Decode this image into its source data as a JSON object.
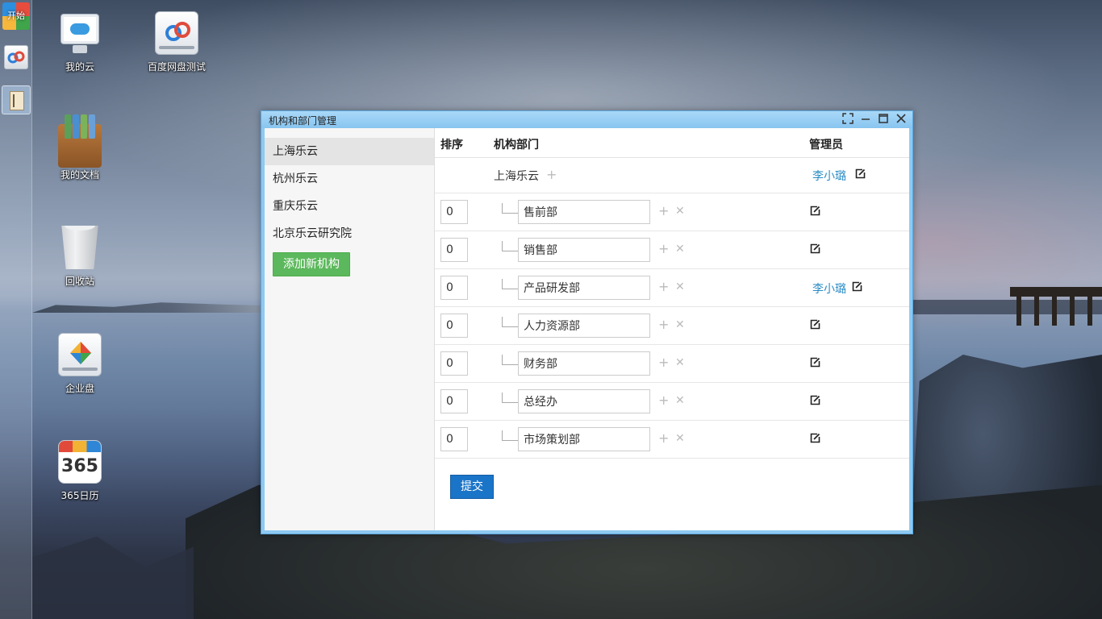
{
  "taskbar": {
    "start_label": "开始"
  },
  "desktop": {
    "icons": [
      {
        "label": "我的云"
      },
      {
        "label": "百度网盘测试"
      },
      {
        "label": "我的文档"
      },
      {
        "label": "回收站"
      },
      {
        "label": "企业盘"
      },
      {
        "label": "365日历",
        "badge": "365"
      }
    ]
  },
  "window": {
    "title": "机构和部门管理",
    "buttons": [
      "fullscreen-icon",
      "minimize-icon",
      "maximize-icon",
      "close-icon"
    ],
    "organizations": [
      "上海乐云",
      "杭州乐云",
      "重庆乐云",
      "北京乐云研究院"
    ],
    "active_org": "上海乐云",
    "add_org_label": "添加新机构",
    "columns": {
      "order": "排序",
      "dept": "机构部门",
      "manager": "管理员"
    },
    "root": {
      "name": "上海乐云",
      "manager": "李小璐"
    },
    "departments": [
      {
        "order": "0",
        "name": "售前部",
        "manager": ""
      },
      {
        "order": "0",
        "name": "销售部",
        "manager": ""
      },
      {
        "order": "0",
        "name": "产品研发部",
        "manager": "李小璐"
      },
      {
        "order": "0",
        "name": "人力资源部",
        "manager": ""
      },
      {
        "order": "0",
        "name": "财务部",
        "manager": ""
      },
      {
        "order": "0",
        "name": "总经办",
        "manager": ""
      },
      {
        "order": "0",
        "name": "市场策划部",
        "manager": ""
      }
    ],
    "submit_label": "提交"
  },
  "colors": {
    "accent": "#1a74c8",
    "add_button": "#5cb85c",
    "manager_link": "#2a8cc5",
    "titlebar": "#88c5f0"
  }
}
